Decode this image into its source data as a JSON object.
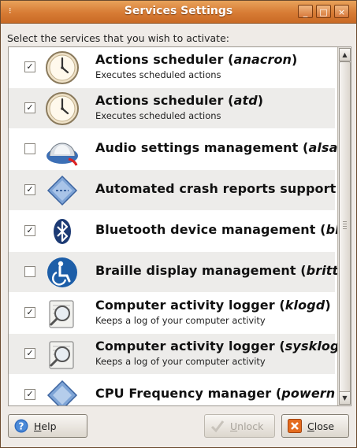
{
  "window": {
    "title": "Services Settings",
    "minimize": "_",
    "maximize": "□",
    "close": "×"
  },
  "prompt": "Select the services that you wish to activate:",
  "services": [
    {
      "name": "Actions scheduler (",
      "daemon": "anacron",
      "suffix": ")",
      "description": "Executes scheduled actions",
      "checked": true,
      "icon": "clock-icon"
    },
    {
      "name": "Actions scheduler (",
      "daemon": "atd",
      "suffix": ")",
      "description": "Executes scheduled actions",
      "checked": true,
      "icon": "clock-icon"
    },
    {
      "name": "Audio settings management (",
      "daemon": "alsa-",
      "suffix": "",
      "description": "",
      "checked": false,
      "icon": "audio-knob-icon"
    },
    {
      "name": "Automated crash reports support",
      "daemon": "",
      "suffix": "",
      "description": "",
      "checked": true,
      "icon": "crash-report-diamond-icon"
    },
    {
      "name": "Bluetooth device management (",
      "daemon": "bl",
      "suffix": "",
      "description": "",
      "checked": true,
      "icon": "bluetooth-icon"
    },
    {
      "name": "Braille display management (",
      "daemon": "britty",
      "suffix": "",
      "description": "",
      "checked": false,
      "icon": "accessibility-icon"
    },
    {
      "name": "Computer activity logger (",
      "daemon": "klogd",
      "suffix": ")",
      "description": "Keeps a log of your computer activity",
      "checked": true,
      "icon": "log-viewer-icon"
    },
    {
      "name": "Computer activity logger (",
      "daemon": "sysklog",
      "suffix": "",
      "description": "Keeps a log of your computer activity",
      "checked": true,
      "icon": "log-viewer-icon"
    },
    {
      "name": "CPU Frequency manager (",
      "daemon": "powern",
      "suffix": "",
      "description": "",
      "checked": true,
      "icon": "cpu-frequency-icon"
    }
  ],
  "buttons": {
    "help": "Help",
    "unlock": "Unlock",
    "close": "Close"
  },
  "checkmark": "✓",
  "scrollbar": {
    "up": "▲",
    "down": "▼"
  }
}
